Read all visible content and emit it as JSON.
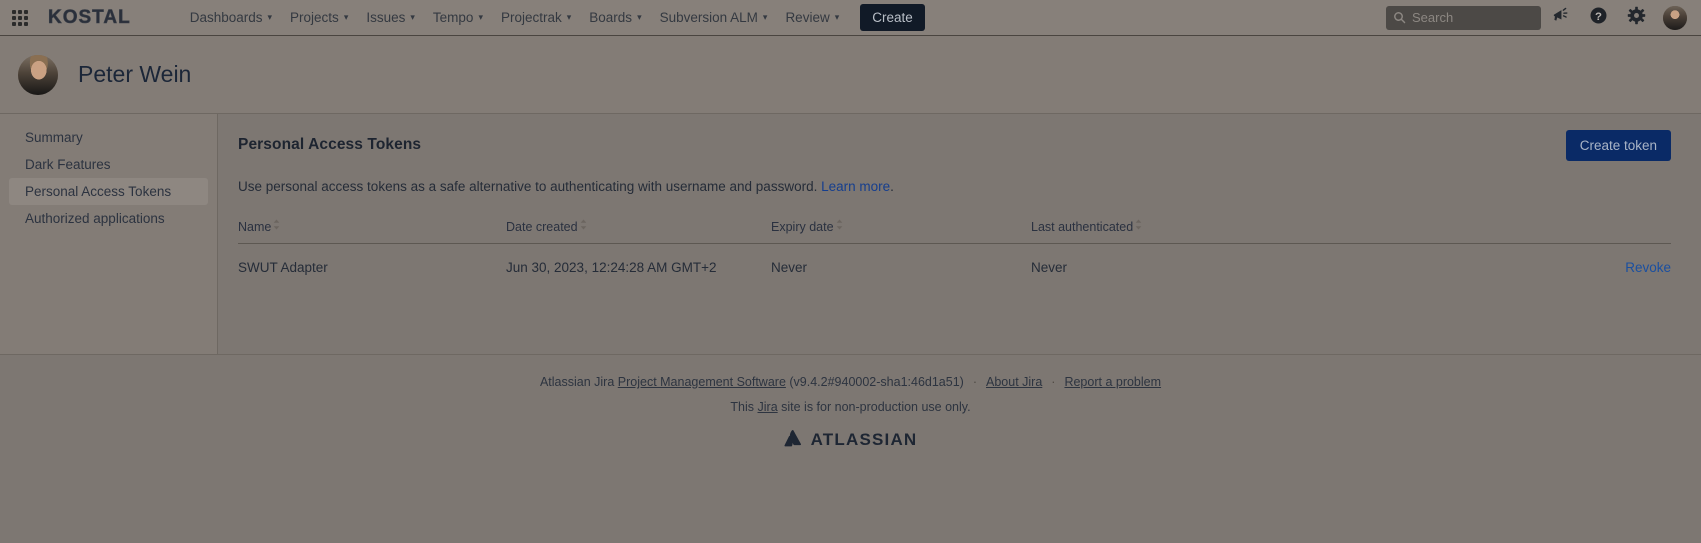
{
  "topnav": {
    "appswitcher_label": "app-switcher",
    "brand": "KOSTAL",
    "items": [
      {
        "label": "Dashboards",
        "caret": "▾"
      },
      {
        "label": "Projects",
        "caret": "▾"
      },
      {
        "label": "Issues",
        "caret": "▾"
      },
      {
        "label": "Tempo",
        "caret": "▾"
      },
      {
        "label": "Projectrak",
        "caret": "▾"
      },
      {
        "label": "Boards",
        "caret": "▾"
      },
      {
        "label": "Subversion ALM",
        "caret": "▾"
      },
      {
        "label": "Review",
        "caret": "▾"
      }
    ],
    "create_label": "Create",
    "search_placeholder": "Search",
    "icons": {
      "search": "search-icon",
      "announcement": "megaphone-icon",
      "help": "help-icon",
      "settings": "gear-icon",
      "avatar": "user-avatar"
    }
  },
  "profile": {
    "name": "Peter Wein"
  },
  "sidebar": {
    "items": [
      {
        "label": "Summary",
        "active": false
      },
      {
        "label": "Dark Features",
        "active": false
      },
      {
        "label": "Personal Access Tokens",
        "active": true
      },
      {
        "label": "Authorized applications",
        "active": false
      }
    ]
  },
  "main": {
    "title": "Personal Access Tokens",
    "create_token_label": "Create token",
    "description_before": "Use personal access tokens as a safe alternative to authenticating with username and password. ",
    "description_link": "Learn more",
    "description_after": ".",
    "table": {
      "columns": [
        {
          "label": "Name",
          "sortable": true
        },
        {
          "label": "Date created",
          "sortable": true
        },
        {
          "label": "Expiry date",
          "sortable": true
        },
        {
          "label": "Last authenticated",
          "sortable": true
        }
      ],
      "sort_glyph": "⌃⌄",
      "rows": [
        {
          "name": "SWUT Adapter",
          "date_created": "Jun 30, 2023, 12:24:28 AM GMT+2",
          "expiry_date": "Never",
          "last_authenticated": "Never",
          "action_label": "Revoke"
        }
      ]
    }
  },
  "footer": {
    "line1_prefix": "Atlassian Jira ",
    "line1_link": "Project Management Software",
    "line1_version": " (v9.4.2#940002-sha1:46d1a51)",
    "sep": "·",
    "about_link": "About Jira",
    "report_link": "Report a problem",
    "line2_prefix": "This ",
    "line2_link": "Jira",
    "line2_suffix": " site is for non-production use only.",
    "logo_mark": "▲",
    "logo_word": "ATLASSIAN"
  }
}
